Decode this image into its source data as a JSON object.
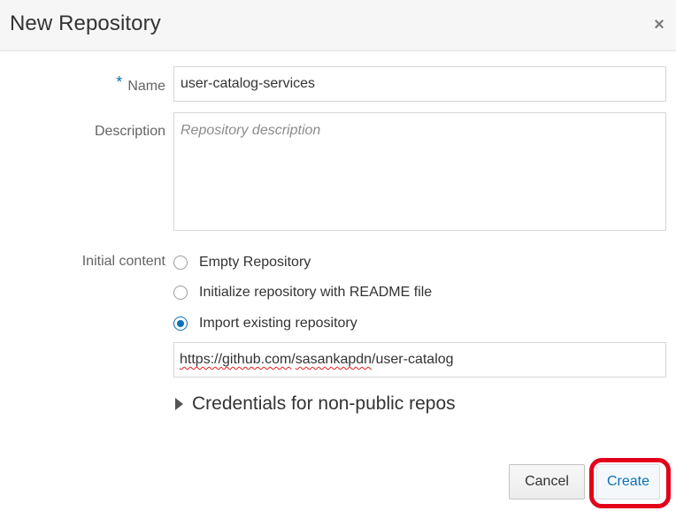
{
  "dialog": {
    "title": "New Repository",
    "close_glyph": "×",
    "close_icon": "close-icon"
  },
  "form": {
    "name": {
      "required_marker": "*",
      "label": "Name",
      "value": "user-catalog-services"
    },
    "description": {
      "label": "Description",
      "value": "",
      "placeholder": "Repository description"
    },
    "initial_content": {
      "label": "Initial content",
      "options": [
        {
          "label": "Empty Repository",
          "selected": false
        },
        {
          "label": "Initialize repository with README file",
          "selected": false
        },
        {
          "label": "Import existing repository",
          "selected": true
        }
      ],
      "import_url": {
        "parts": [
          "https://",
          "github.com",
          "/",
          "sasankapdn",
          "/user-catalog"
        ]
      }
    },
    "credentials": {
      "label": "Credentials for non-public repos",
      "icon": "triangle-right-icon",
      "expanded": false
    }
  },
  "footer": {
    "cancel_label": "Cancel",
    "create_label": "Create",
    "highlight_color": "#e3001b"
  },
  "colors": {
    "accent": "#0b72b5",
    "header_bg": "#f6f6f6"
  }
}
